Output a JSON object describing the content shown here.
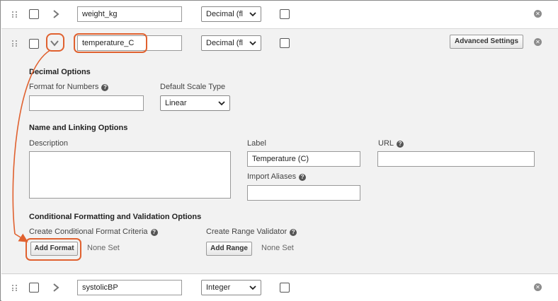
{
  "rows": [
    {
      "field_name": "weight_kg",
      "data_type": "Decimal (fl"
    },
    {
      "field_name": "temperature_C",
      "data_type": "Decimal (fl",
      "advanced_settings_label": "Advanced Settings"
    },
    {
      "field_name": "systolicBP",
      "data_type": "Integer"
    }
  ],
  "icons": {
    "drag": "drag-handle-icon",
    "expand": "chevron-right-icon",
    "collapse": "chevron-down-icon",
    "remove": "remove-icon",
    "help": "help-icon"
  },
  "expanded": {
    "decimal_options": {
      "heading": "Decimal Options",
      "format_label": "Format for Numbers",
      "format_value": "",
      "scale_label": "Default Scale Type",
      "scale_value": "Linear"
    },
    "name_linking": {
      "heading": "Name and Linking Options",
      "description_label": "Description",
      "description_value": "",
      "label_label": "Label",
      "label_value": "Temperature (C)",
      "url_label": "URL",
      "url_value": "",
      "aliases_label": "Import Aliases",
      "aliases_value": ""
    },
    "conditional": {
      "heading": "Conditional Formatting and Validation Options",
      "criteria_label": "Create Conditional Format Criteria",
      "add_format_label": "Add Format",
      "criteria_status": "None Set",
      "range_label": "Create Range Validator",
      "add_range_label": "Add Range",
      "range_status": "None Set"
    }
  },
  "colors": {
    "highlight": "#e0612f",
    "expanded_bg": "#f2f2f2"
  }
}
